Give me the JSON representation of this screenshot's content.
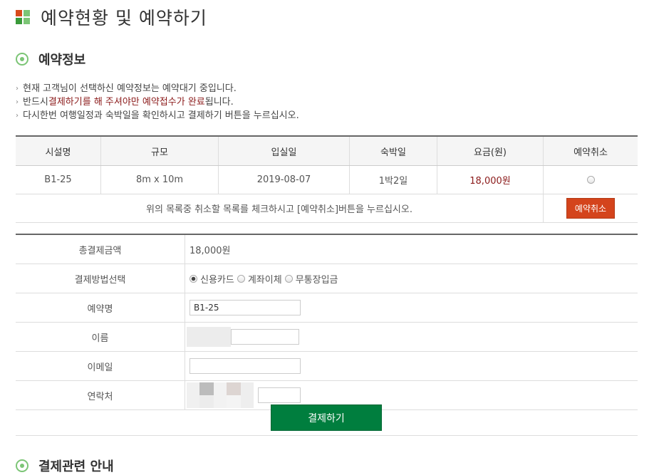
{
  "header": {
    "title": "예약현황 및 예약하기",
    "logo_colors": [
      "#d84a1b",
      "#7cc576",
      "#3a9a3a",
      "#7cc576"
    ]
  },
  "section1": {
    "title": "예약정보"
  },
  "notice": {
    "line1": "현재 고객님이 선택하신 예약정보는 예약대기 중입니다.",
    "line2_a": "반드시 ",
    "line2_hl1": "결제하기를 해 주셔야만 예약접수가 완료",
    "line2_b": "됩니다.",
    "line3": "다시한번 여행일정과 숙박일을 확인하시고 결제하기 버튼을 누르십시오."
  },
  "reservation_table": {
    "headers": [
      "시설명",
      "규모",
      "입실일",
      "숙박일",
      "요금(원)",
      "예약취소"
    ],
    "rows": [
      {
        "facility": "B1-25",
        "size": "8m x 10m",
        "checkin": "2019-08-07",
        "nights": "1박2일",
        "price": "18,000원"
      }
    ],
    "cancel_note": "위의 목록중 취소할 목록를 체크하시고 [예약취소]버튼을 누르십시오.",
    "cancel_button": "예약취소"
  },
  "payment": {
    "total_label": "총결제금액",
    "total_value": "18,000원",
    "method_label": "결제방법선택",
    "methods": [
      "신용카드",
      "계좌이체",
      "무통장입금"
    ],
    "selected_method": "신용카드",
    "reservation_name_label": "예약명",
    "reservation_name_value": "B1-25",
    "name_label": "이름",
    "email_label": "이메일",
    "contact_label": "연락처"
  },
  "submit": {
    "label": "결제하기"
  },
  "section2": {
    "title": "결제관련 안내"
  }
}
